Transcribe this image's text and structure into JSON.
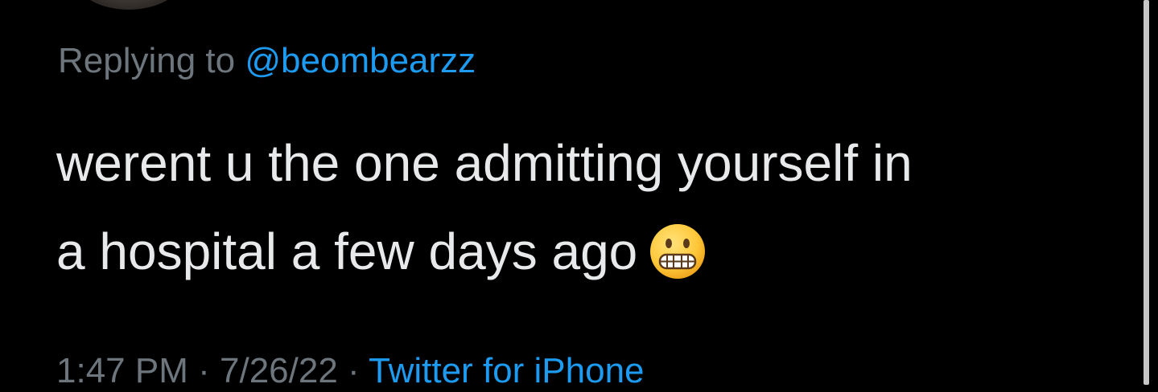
{
  "tweet": {
    "replying_prefix": "Replying to",
    "replying_handle": "@beombearzz",
    "text_line1": "werent u the one admitting yourself in",
    "text_line2": "a hospital a few days ago",
    "emoji": "grimacing-face-icon",
    "time": "1:47 PM",
    "date": "7/26/22",
    "separator": "·",
    "source": "Twitter for iPhone"
  },
  "colors": {
    "background": "#000000",
    "primary_text": "#e7e9ea",
    "secondary_text": "#6e767d",
    "link": "#1d9bf0"
  }
}
